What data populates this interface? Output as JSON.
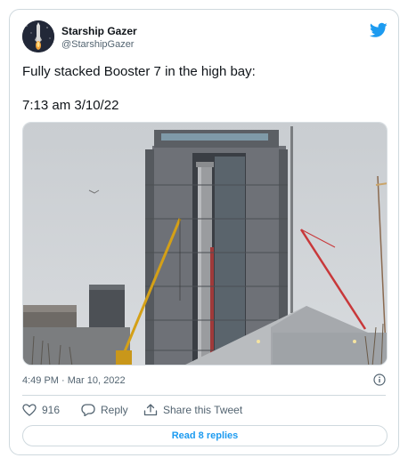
{
  "tweet": {
    "author_name": "Starship Gazer",
    "author_handle": "@StarshipGazer",
    "text_line_1": "Fully stacked Booster 7 in the high bay:",
    "text_line_2": "7:13 am 3/10/22",
    "timestamp": "4:49 PM · Mar 10, 2022"
  },
  "actions": {
    "like_count": "916",
    "reply_label": "Reply",
    "share_label": "Share this Tweet",
    "read_replies_label": "Read 8 replies"
  },
  "icons": {
    "brand": "twitter-bird-icon",
    "like": "heart-icon",
    "reply": "reply-bubble-icon",
    "share": "share-icon",
    "info": "info-icon"
  },
  "colors": {
    "accent": "#1d9bf0",
    "text": "#0f1419",
    "muted": "#536471",
    "border": "#cfd9de"
  }
}
